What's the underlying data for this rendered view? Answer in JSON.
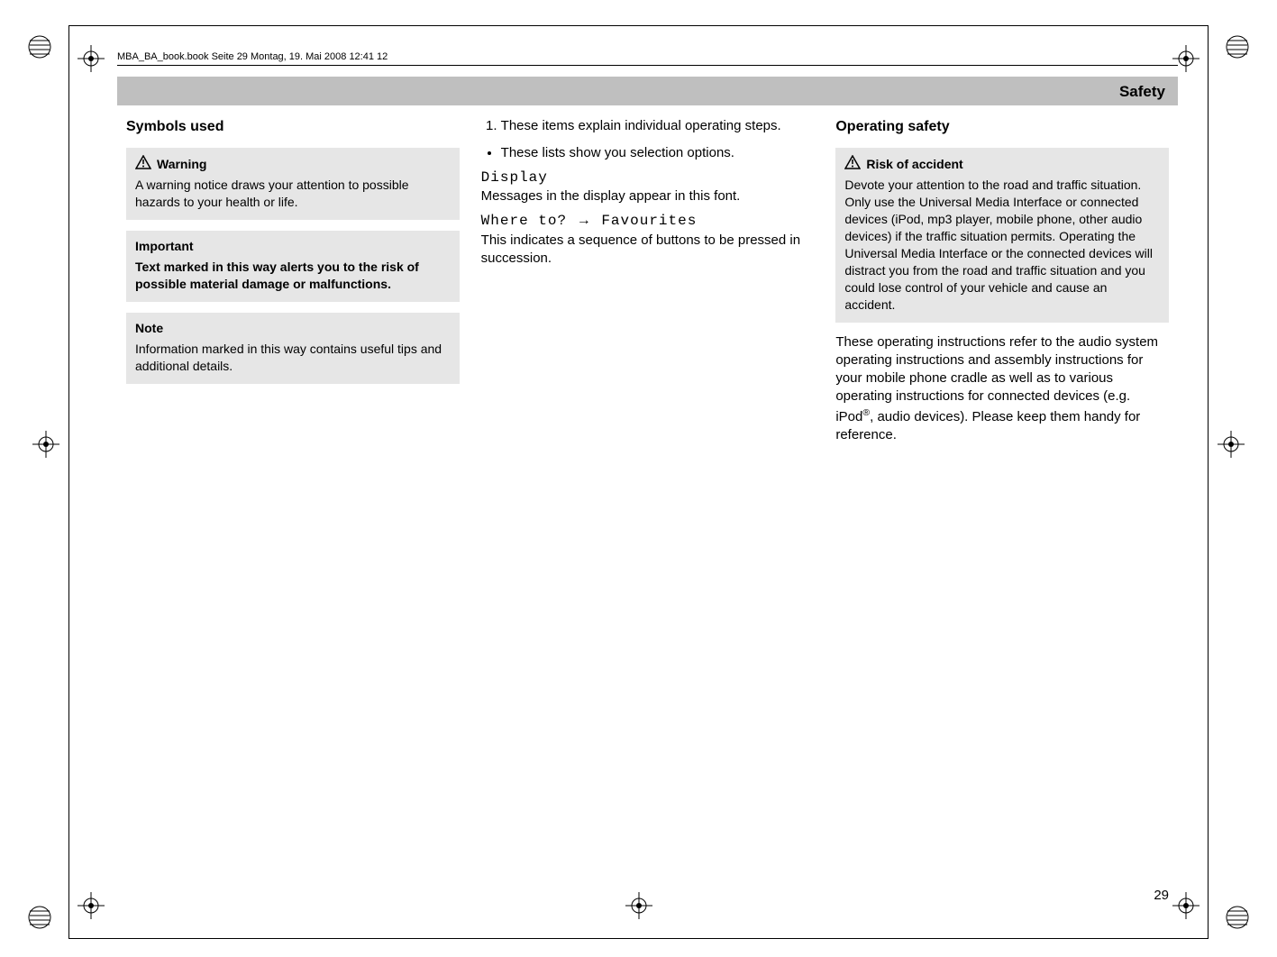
{
  "header": {
    "running_head": "MBA_BA_book.book  Seite 29  Montag, 19. Mai 2008  12:41 12",
    "title_bar": "Safety"
  },
  "col1": {
    "heading": "Symbols used",
    "warning_box": {
      "title": "Warning",
      "body": "A warning notice draws your attention to possible hazards to your health or life."
    },
    "important_box": {
      "title": "Important",
      "body": "Text marked in this way alerts you to the risk of possible material damage or malfunctions."
    },
    "note_box": {
      "title": "Note",
      "body": "Information marked in this way contains useful tips and additional details."
    }
  },
  "col2": {
    "step_item": "These items explain individual operating steps.",
    "bullet_item": "These lists show you selection options.",
    "display_label": "Display",
    "display_caption": "Messages in the display appear in this font.",
    "sequence_left": "Where to?",
    "sequence_arrow": "→",
    "sequence_right": "Favourites",
    "sequence_caption": "This indicates a sequence of buttons to be pressed in succession."
  },
  "col3": {
    "heading": "Operating safety",
    "risk_box": {
      "title": "Risk of accident",
      "body": "Devote your attention to the road and traffic situation. Only use the Universal Media Interface or connected devices (iPod, mp3 player, mobile phone, other audio devices) if the traffic situation permits. Operating the Universal Media Interface or the connected devices will distract you from the road and traffic situation and you could lose control of your vehicle and cause an accident."
    },
    "body_para_pre": "These operating instructions refer to the audio system operating instructions and assembly instructions for your mobile phone cradle as well as to various operating instructions for connected devices (e.g. iPod",
    "body_para_post": ", audio devices). Please keep them handy for reference."
  },
  "page_number": "29"
}
